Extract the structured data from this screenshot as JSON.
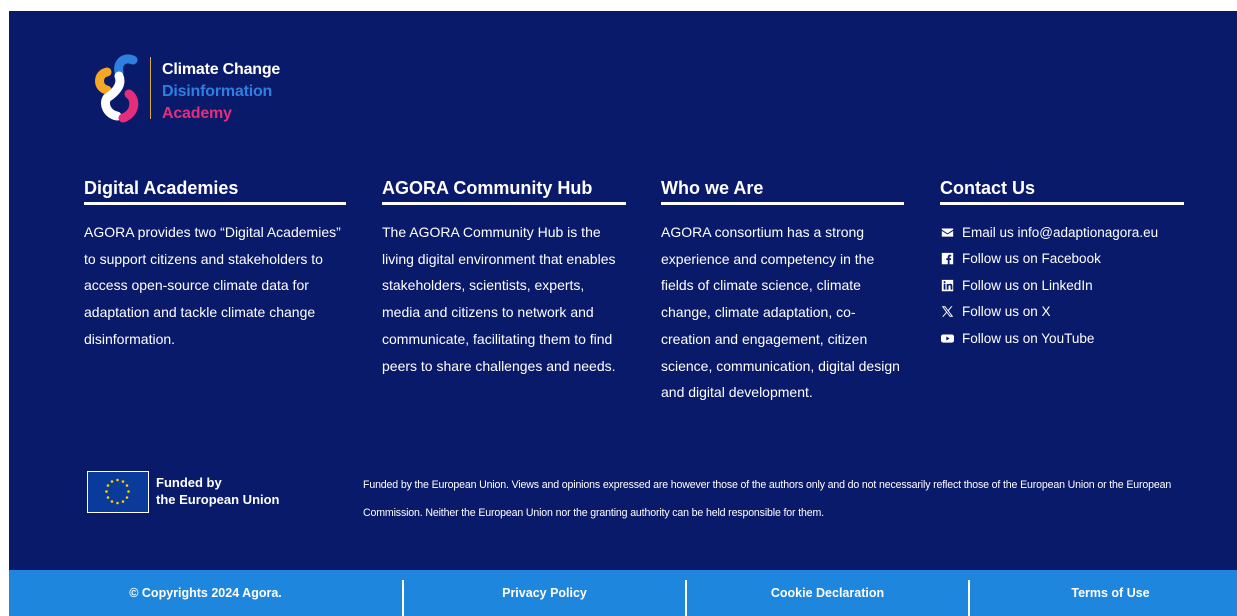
{
  "logo": {
    "line1": "Climate Change",
    "line2": "Disinformation",
    "line3": "Academy"
  },
  "columns": {
    "academies": {
      "title": "Digital Academies",
      "body": "AGORA provides two “Digital Academies” to support citizens and stakeholders to access open-source climate data for adaptation and tackle climate change disinformation."
    },
    "hub": {
      "title": "AGORA Community Hub",
      "body": "The AGORA Community Hub is the living digital environment that enables stakeholders, scientists, experts, media and citizens to network and communicate, facilitating them to find peers  to share challenges and needs."
    },
    "who": {
      "title": "Who we Are",
      "body": "AGORA consortium has a strong experience and competency in the fields of climate science, climate change, climate adaptation, co-creation and engagement, citizen science, communication, digital design and digital development."
    },
    "contact": {
      "title": "Contact Us",
      "items": [
        {
          "icon": "envelope-icon",
          "label": "Email us info@adaptionagora.eu"
        },
        {
          "icon": "facebook-icon",
          "label": "Follow us on Facebook"
        },
        {
          "icon": "linkedin-icon",
          "label": "Follow us on LinkedIn"
        },
        {
          "icon": "x-icon",
          "label": "Follow us on X"
        },
        {
          "icon": "youtube-icon",
          "label": "Follow us on YouTube"
        }
      ]
    }
  },
  "eu": {
    "line1": "Funded by",
    "line2": "the European Union",
    "disclaimer": "Funded by the European Union. Views and opinions expressed are however those of the authors only and do not necessarily reflect those of the European Union or the European Commission. Neither the European Union nor the granting authority can be held responsible for them."
  },
  "bottom_bar": {
    "copyright": "© Copyrights 2024 Agora.",
    "privacy": "Privacy Policy",
    "cookie": "Cookie Declaration",
    "terms": "Terms of Use"
  },
  "colors": {
    "footer_bg": "#0a1a6b",
    "bottom_bar_bg": "#1f86dd",
    "logo_blue": "#2f7fe0",
    "logo_pink": "#e52e7b",
    "logo_orange": "#f5a623"
  }
}
